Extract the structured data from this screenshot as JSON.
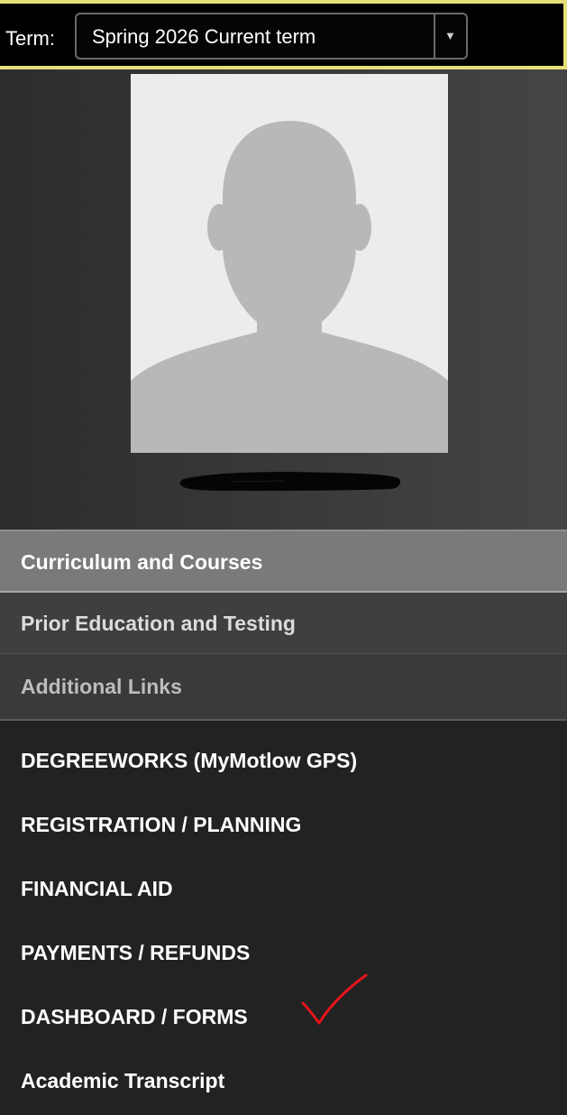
{
  "term": {
    "label": "Term:",
    "selected": "Spring 2026 Current term",
    "caret_icon": "dropdown-caret-icon"
  },
  "profile": {
    "avatar_icon": "default-person-silhouette-icon",
    "name_redacted": true
  },
  "sections": [
    {
      "label": "Curriculum and Courses",
      "active": true
    },
    {
      "label": "Prior Education and Testing",
      "active": false
    },
    {
      "label": "Additional Links",
      "active": false
    }
  ],
  "links": [
    "DEGREEWORKS (MyMotlow GPS)",
    "REGISTRATION / PLANNING",
    "FINANCIAL AID",
    "PAYMENTS / REFUNDS",
    "DASHBOARD / FORMS",
    "Academic Transcript"
  ],
  "annotation": {
    "icon": "red-checkmark-icon",
    "color": "#e8141a"
  },
  "colors": {
    "term_border": "#e6e07a",
    "active_section_bg": "#7a7a7a",
    "sidebar_bg": "#222222"
  }
}
